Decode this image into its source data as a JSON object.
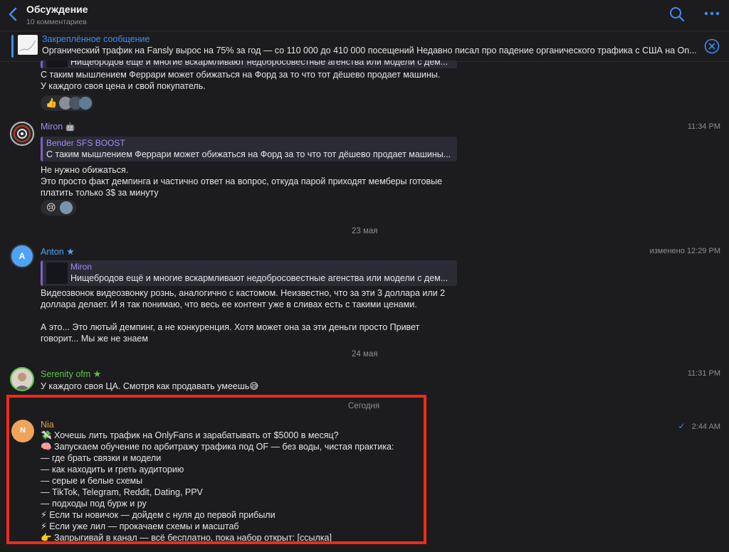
{
  "header": {
    "title": "Обсуждение",
    "subtitle": "10 комментариев",
    "accent_color": "#3d8ef3"
  },
  "pinned": {
    "title": "Закреплённое сообщение",
    "text": "Органический трафик на Fansly вырос на 75% за год — со 110 000 до 410 000 посещений  Недавно писал про падение органического трафика с США на On..."
  },
  "messages": [
    {
      "quote_text": "Нищебродов ещё и многие  вскармливают недобросовестные агенства или модели с дем...",
      "text": "С таким мышлением Феррари может обижаться на Форд за то что тот дёшево продает машины.\nУ каждого своя цена и свой покупатель.",
      "reactions": [
        "👍"
      ]
    },
    {
      "author": "Miron",
      "author_color": "#a58bf0",
      "badge": "🤖",
      "time": "11:34 PM",
      "quote_author": "Bender SFS BOOST",
      "quote_text": "С таким мышлением Феррари может обижаться на Форд за то что тот дёшево продает машины...",
      "text": "Не нужно обижаться.\nЭто просто факт демпинга и частично ответ на вопрос, откуда парой приходят мемберы готовые\nплатить только 3$ за минуту",
      "reactions": [
        "😢"
      ]
    },
    {
      "date_separator": "23 мая",
      "author": "Anton",
      "author_color": "#4fa3f7",
      "badge": "★",
      "avatar_letter": "A",
      "time": "изменено 12:29 PM",
      "quote_author": "Miron",
      "quote_text": "Нищебродов ещё и многие  вскармливают недобросовестные агенства или модели с дем...",
      "text": "Видеозвонок видеозвонку рознь, аналогично с кастомом. Неизвестно, что за эти 3 доллара или 2\nдоллара делает. И я так понимаю, что весь ее контент уже в сливах есть с такими ценами.\n\nА это... Это лютый демпинг, а не конкуренция. Хотя может она за эти деньги просто Привет\nговорит... Мы же не знаем"
    },
    {
      "date_separator": "24 мая",
      "author": "Serenity ofm",
      "author_color": "#5cc24a",
      "badge": "★",
      "time": "11:31 PM",
      "text": "У каждого своя ЦА. Смотря как продавать умеешь😅"
    },
    {
      "date_separator": "Сегодня",
      "author": "Nia",
      "author_color": "#e8a33d",
      "avatar_letter": "N",
      "status_icon": "✓",
      "time": "2:44 AM",
      "text": "💸 Хочешь лить трафик на OnlyFans и зарабатывать от $5000 в месяц?\n🧠 Запускаем обучение по арбитражу трафика под OF — без воды, чистая практика:\n— где брать связки и модели\n— как находить и греть аудиторию\n— серые и белые схемы\n— TikTok, Telegram, Reddit, Dating, PPV\n— подходы под бурж и ру\n⚡ Если ты новичок — дойдем с нуля до первой прибыли\n⚡ Если уже лил — прокачаем схемы и масштаб\n👉 Запрыгивай в канал — всё бесплатно, пока набор открыт: [ссылка]",
      "highlight_color": "#f02a1a"
    }
  ],
  "icons": {
    "back": "chevron-left-icon",
    "search": "search-icon",
    "more": "more-icon",
    "close": "close-circle-icon"
  }
}
